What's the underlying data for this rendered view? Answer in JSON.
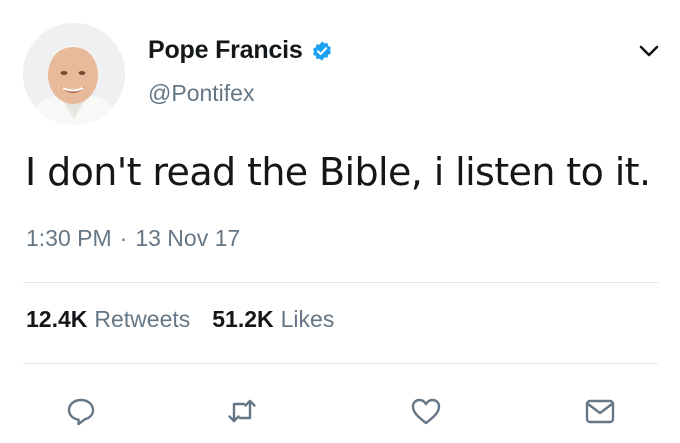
{
  "tweet": {
    "author": {
      "display_name": "Pope Francis",
      "handle": "@Pontifex",
      "verified": true,
      "avatar_icon": "avatar-photo"
    },
    "text": "I don't read the Bible, i listen to it.",
    "time": "1:30 PM",
    "separator": "·",
    "date": "13 Nov 17",
    "stats": {
      "retweets_count": "12.4K",
      "retweets_label": "Retweets",
      "likes_count": "51.2K",
      "likes_label": "Likes"
    },
    "actions": {
      "reply_icon": "reply-icon",
      "retweet_icon": "retweet-icon",
      "like_icon": "heart-icon",
      "message_icon": "envelope-icon"
    },
    "menu_icon": "chevron-down-icon"
  },
  "colors": {
    "text": "#14171a",
    "secondary": "#657786",
    "verified_blue": "#1da1f2",
    "divider": "#e1e8ed"
  }
}
